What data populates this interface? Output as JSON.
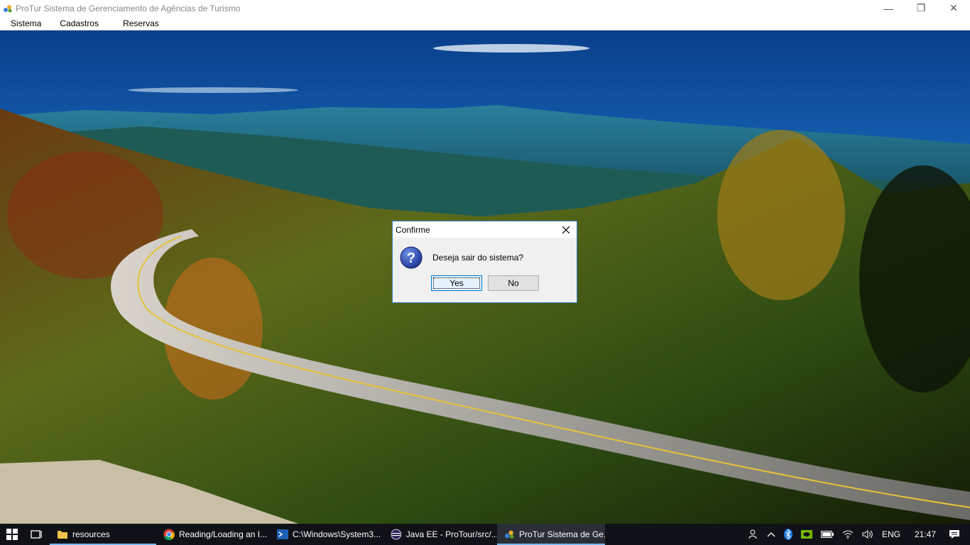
{
  "window": {
    "title": "ProTur Sistema de Gerenciamento de Agências de Turismo",
    "minimize_glyph": "—",
    "maximize_glyph": "❐",
    "close_glyph": "✕"
  },
  "menu": {
    "items": [
      {
        "label": "Sistema"
      },
      {
        "label": "Cadastros"
      },
      {
        "label": "Reservas"
      }
    ]
  },
  "dialog": {
    "title": "Confirme",
    "message": "Deseja sair do sistema?",
    "yes_label": "Yes",
    "no_label": "No",
    "icon": "question-icon"
  },
  "taskbar": {
    "items": [
      {
        "label": "resources",
        "icon": "folder-icon",
        "active": true
      },
      {
        "label": "Reading/Loading an I...",
        "icon": "chrome-icon",
        "active": false
      },
      {
        "label": "C:\\Windows\\System3...",
        "icon": "terminal-icon",
        "active": false
      },
      {
        "label": "Java EE - ProTour/src/...",
        "icon": "eclipse-icon",
        "active": false
      },
      {
        "label": "ProTur Sistema de Ge...",
        "icon": "app-icon",
        "active": true
      }
    ],
    "tray": {
      "language": "ENG",
      "time": "21:47"
    }
  },
  "colors": {
    "accent": "#0078d7",
    "taskbar": "#101218",
    "dialog_border": "#3c7fc9"
  }
}
